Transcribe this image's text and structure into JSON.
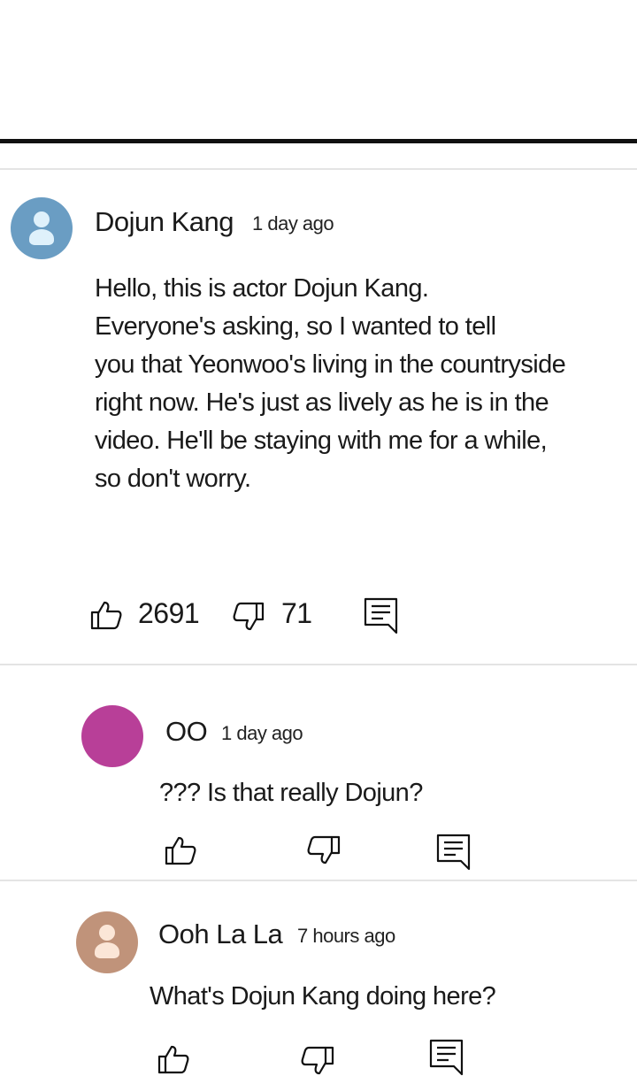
{
  "comments": [
    {
      "author": "Dojun Kang",
      "time": "1 day ago",
      "text": "Hello, this is actor Dojun Kang.\nEveryone's asking, so I wanted to tell\nyou that Yeonwoo's living in the countryside\nright now. He's just as lively as he is in the\nvideo. He'll be staying with me for a while,\nso don't worry.",
      "likes": "2691",
      "dislikes": "71",
      "avatar_color": "#6a9dc3",
      "avatar_figure_color": "#dff1fb"
    },
    {
      "author": "OO",
      "time": "1 day ago",
      "text": "??? Is that really Dojun?",
      "avatar_color": "#b83f98"
    },
    {
      "author": "Ooh La La",
      "time": "7 hours ago",
      "text": "What's Dojun Kang doing here?",
      "avatar_color": "#c0937a",
      "avatar_figure_color": "#fbe6d7"
    }
  ],
  "icons": {
    "like": "thumbs-up-icon",
    "dislike": "thumbs-down-icon",
    "reply": "reply-comment-icon"
  }
}
